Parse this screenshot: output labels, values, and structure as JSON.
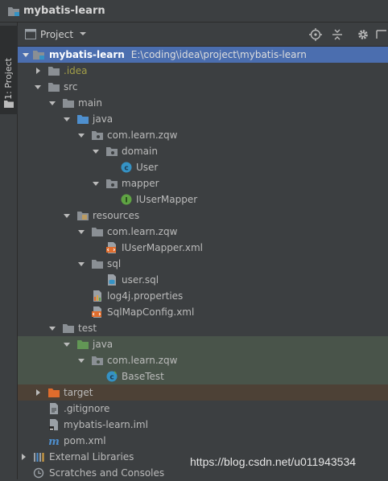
{
  "window": {
    "title": "mybatis-learn"
  },
  "side_strip": {
    "label": "1: Project"
  },
  "toolbar": {
    "view_label": "Project"
  },
  "tree": {
    "root": {
      "name": "mybatis-learn",
      "path": "E:\\coding\\idea\\project\\mybatis-learn"
    },
    "idea": ".idea",
    "src": "src",
    "main": "main",
    "main_java": "java",
    "pkg_main": "com.learn.zqw",
    "domain": "domain",
    "user": "User",
    "mapper": "mapper",
    "iusermapper": "IUserMapper",
    "resources": "resources",
    "pkg_res": "com.learn.zqw",
    "iusermapper_xml": "IUserMapper.xml",
    "sql": "sql",
    "user_sql": "user.sql",
    "log4j": "log4j.properties",
    "sqlmapconfig": "SqlMapConfig.xml",
    "test": "test",
    "test_java": "java",
    "pkg_test": "com.learn.zqw",
    "basetest": "BaseTest",
    "target": "target",
    "gitignore": ".gitignore",
    "iml": "mybatis-learn.iml",
    "pom": "pom.xml",
    "external_libraries": "External Libraries",
    "scratches": "Scratches and Consoles"
  },
  "watermark": "https://blog.csdn.net/u011943534",
  "colors": {
    "background": "#3c3f41",
    "selection": "#4b6eaf",
    "test_highlight": "#49544a",
    "excluded_highlight": "#4d4136",
    "folder": "#8a8f94",
    "source_folder": "#4e8fce",
    "test_folder": "#629755",
    "excluded_folder": "#e06c2c",
    "class_icon": "#3592c4",
    "interface_icon": "#5fa443"
  }
}
